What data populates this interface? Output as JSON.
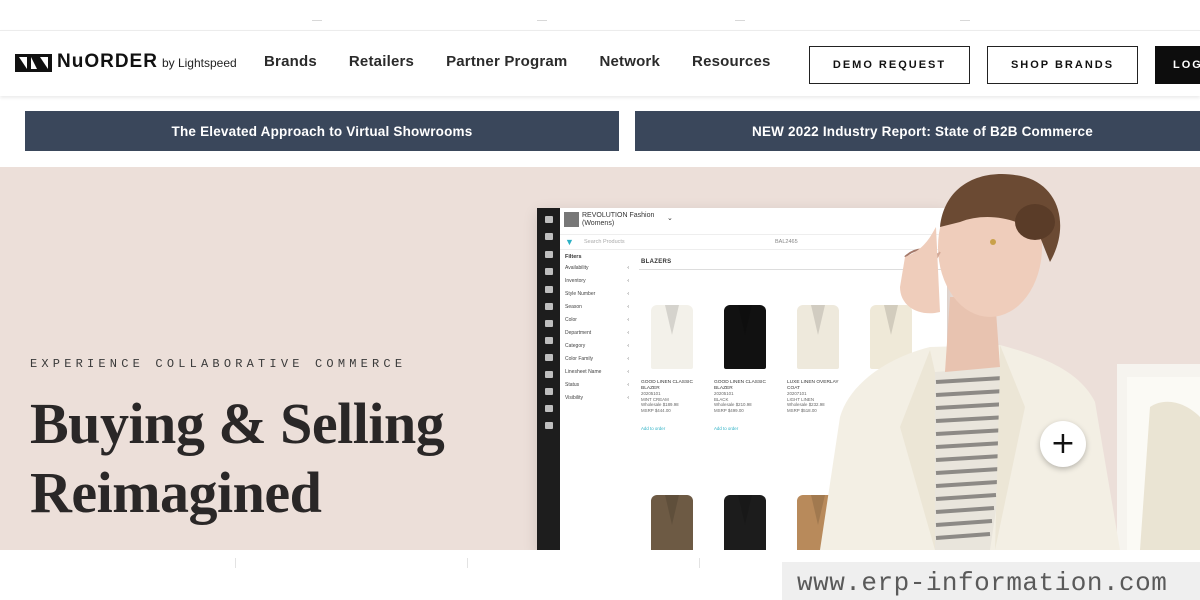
{
  "header": {
    "logo_text": "NuORDER",
    "logo_suffix": "by Lightspeed",
    "nav": [
      "Brands",
      "Retailers",
      "Partner Program",
      "Network",
      "Resources"
    ],
    "demo_button": "DEMO REQUEST",
    "shop_button": "SHOP BRANDS",
    "login_button": "LOG"
  },
  "banners": [
    "The Elevated Approach to Virtual Showrooms",
    "NEW 2022 Industry Report: State of B2B Commerce"
  ],
  "hero": {
    "eyebrow": "EXPERIENCE COLLABORATIVE COMMERCE",
    "headline_line1": "Buying & Selling",
    "headline_line2": "Reimagined",
    "background_color": "#ecdfd9",
    "expand_icon": "plus-icon"
  },
  "app_mockup": {
    "brand_title": "REVOLUTION Fashion",
    "brand_subtitle": "(Womens)",
    "search_placeholder": "Search Products",
    "search_code": "BAL2465",
    "filters_heading": "Filters",
    "filters": [
      "Availability",
      "Inventory",
      "Style Number",
      "Season",
      "Color",
      "Department",
      "Category",
      "Color Family",
      "Linesheet Name",
      "Status",
      "Visibility"
    ],
    "category": "BLAZERS",
    "products": [
      {
        "name": "GOOD LINEN CLASSIC BLAZER",
        "sku": "20205101",
        "color": "MINT CREAM",
        "wholesale": "Wholesale $189.98",
        "msrp": "MSRP $444.00",
        "link": "Add to order",
        "swatch": "#f3f1ea"
      },
      {
        "name": "GOOD LINEN CLASSIC BLAZER",
        "sku": "20205101",
        "color": "BLACK",
        "wholesale": "Wholesale $210.98",
        "msrp": "MSRP $499.00",
        "link": "Add to order",
        "swatch": "#111111"
      },
      {
        "name": "LUXE LINEN OVERLAY COAT",
        "sku": "20207101",
        "color": "LIGHT LINEN",
        "wholesale": "Wholesale $232.98",
        "msrp": "MSRP $518.00",
        "link": "",
        "swatch": "#eee9dc"
      },
      {
        "name": "",
        "sku": "",
        "color": "",
        "wholesale": "",
        "msrp": "",
        "link": "",
        "swatch": "#efe9d8"
      }
    ],
    "row2_swatches": [
      "#6d5a44",
      "#1c1c1c",
      "#b88a5b"
    ]
  },
  "watermark": "www.erp-information.com"
}
